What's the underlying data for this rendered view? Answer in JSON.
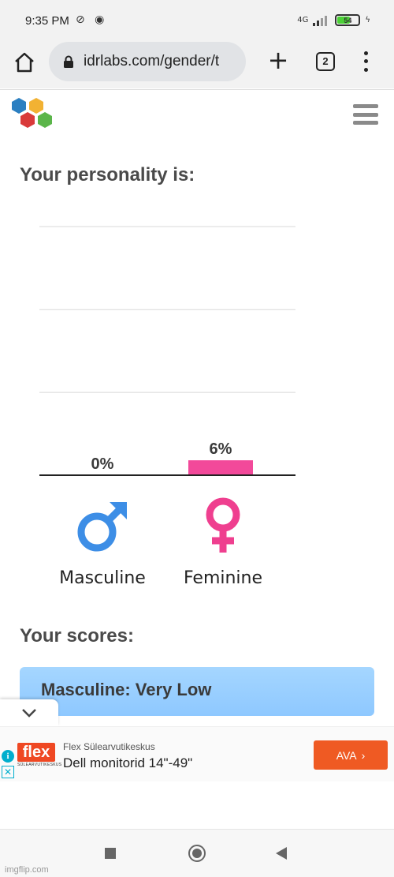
{
  "status_bar": {
    "time": "9:35 PM",
    "network": "4G",
    "battery": "54"
  },
  "browser": {
    "url": "idrlabs.com/gender/t",
    "tab_count": "2"
  },
  "page": {
    "heading": "Your personality is:",
    "scores_heading": "Your scores:",
    "score_item": "Masculine: Very Low"
  },
  "chart_data": {
    "type": "bar",
    "categories": [
      "Masculine",
      "Feminine"
    ],
    "values": [
      0,
      6
    ],
    "value_labels": [
      "0%",
      "6%"
    ],
    "colors": [
      "#4a90e2",
      "#f2499a"
    ],
    "ylim": [
      0,
      100
    ],
    "grid": true
  },
  "gender": {
    "male_label": "Masculine",
    "female_label": "Feminine",
    "male_color": "#3d8ee6",
    "female_color": "#ef3f8f"
  },
  "ad": {
    "advertiser": "Flex Sülearvutikeskus",
    "headline": "Dell monitorid 14\"-49\"",
    "cta": "AVA",
    "logo_text": "flex",
    "logo_sub": "SÜLEARVUTIKESKUS"
  },
  "watermark": "imgflip.com"
}
